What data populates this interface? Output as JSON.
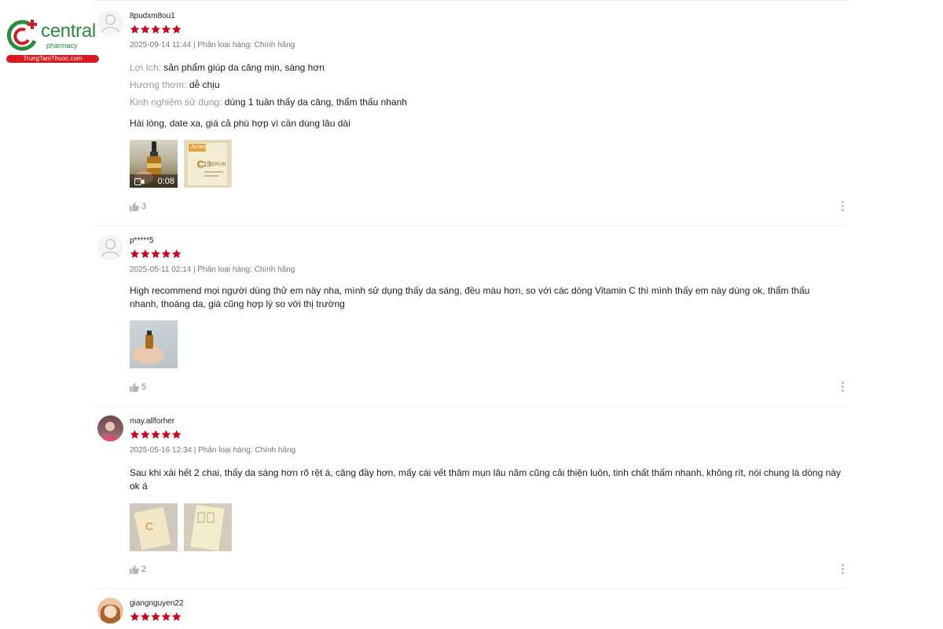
{
  "brand": {
    "name": "central",
    "sub": "pharmacy",
    "domain": "TrungTamThuoc.com",
    "colors": {
      "green": "#2e8b3e",
      "red": "#d71920"
    }
  },
  "rating_color": "#d0011b",
  "reviews": [
    {
      "username": "8pudxm8ou1",
      "stars": 5,
      "meta": "2025-09-14 11:44 | Phân loại hàng: Chính hãng",
      "attributes": [
        {
          "label": "Lợi ích:",
          "value": "sản phẩm giúp da căng mịn, sáng hơn"
        },
        {
          "label": "Hương thơm:",
          "value": "dễ chịu"
        },
        {
          "label": "Kinh nghiệm sử dụng:",
          "value": "dùng 1 tuần thấy da căng, thẩm thấu nhanh"
        }
      ],
      "comment": "Hài lòng, date xa, giá cả phù hợp vì cần dùng lâu dài",
      "media": [
        {
          "type": "video",
          "duration": "0:08"
        },
        {
          "type": "image",
          "text_top": "Acnes",
          "text_mid": "C15",
          "text_sub": "SERUM"
        }
      ],
      "likes": "3"
    },
    {
      "username": "p*****5",
      "stars": 5,
      "meta": "2025-05-11 02:14 | Phân loại hàng: Chính hãng",
      "attributes": [],
      "comment": "High recommend mọi người dùng thử em này nha, mình sử dụng thấy da sáng, đều màu hơn, so với các dòng Vitamin C thì mình thấy em này dùng ok, thẩm thấu nhanh, thoáng da, giá cũng hợp lý so với thị trường",
      "media": [
        {
          "type": "image"
        }
      ],
      "likes": "5"
    },
    {
      "username": "may.allforher",
      "stars": 5,
      "meta": "2025-05-16 12:34 | Phân loại hàng: Chính hãng",
      "attributes": [],
      "comment": "Sau khi xài hết 2 chai, thấy da sáng hơn rõ rệt á, căng đầy hơn, mấy cái vết thâm mụn lâu năm cũng cải thiện luôn, tinh chất thấm nhanh, không rít, nói chung là dòng này ok á",
      "media": [
        {
          "type": "image"
        },
        {
          "type": "image"
        }
      ],
      "likes": "2"
    },
    {
      "username": "giangnguyen22",
      "stars": 5,
      "meta": "",
      "attributes": [],
      "comment": "",
      "media": [],
      "likes": ""
    }
  ]
}
